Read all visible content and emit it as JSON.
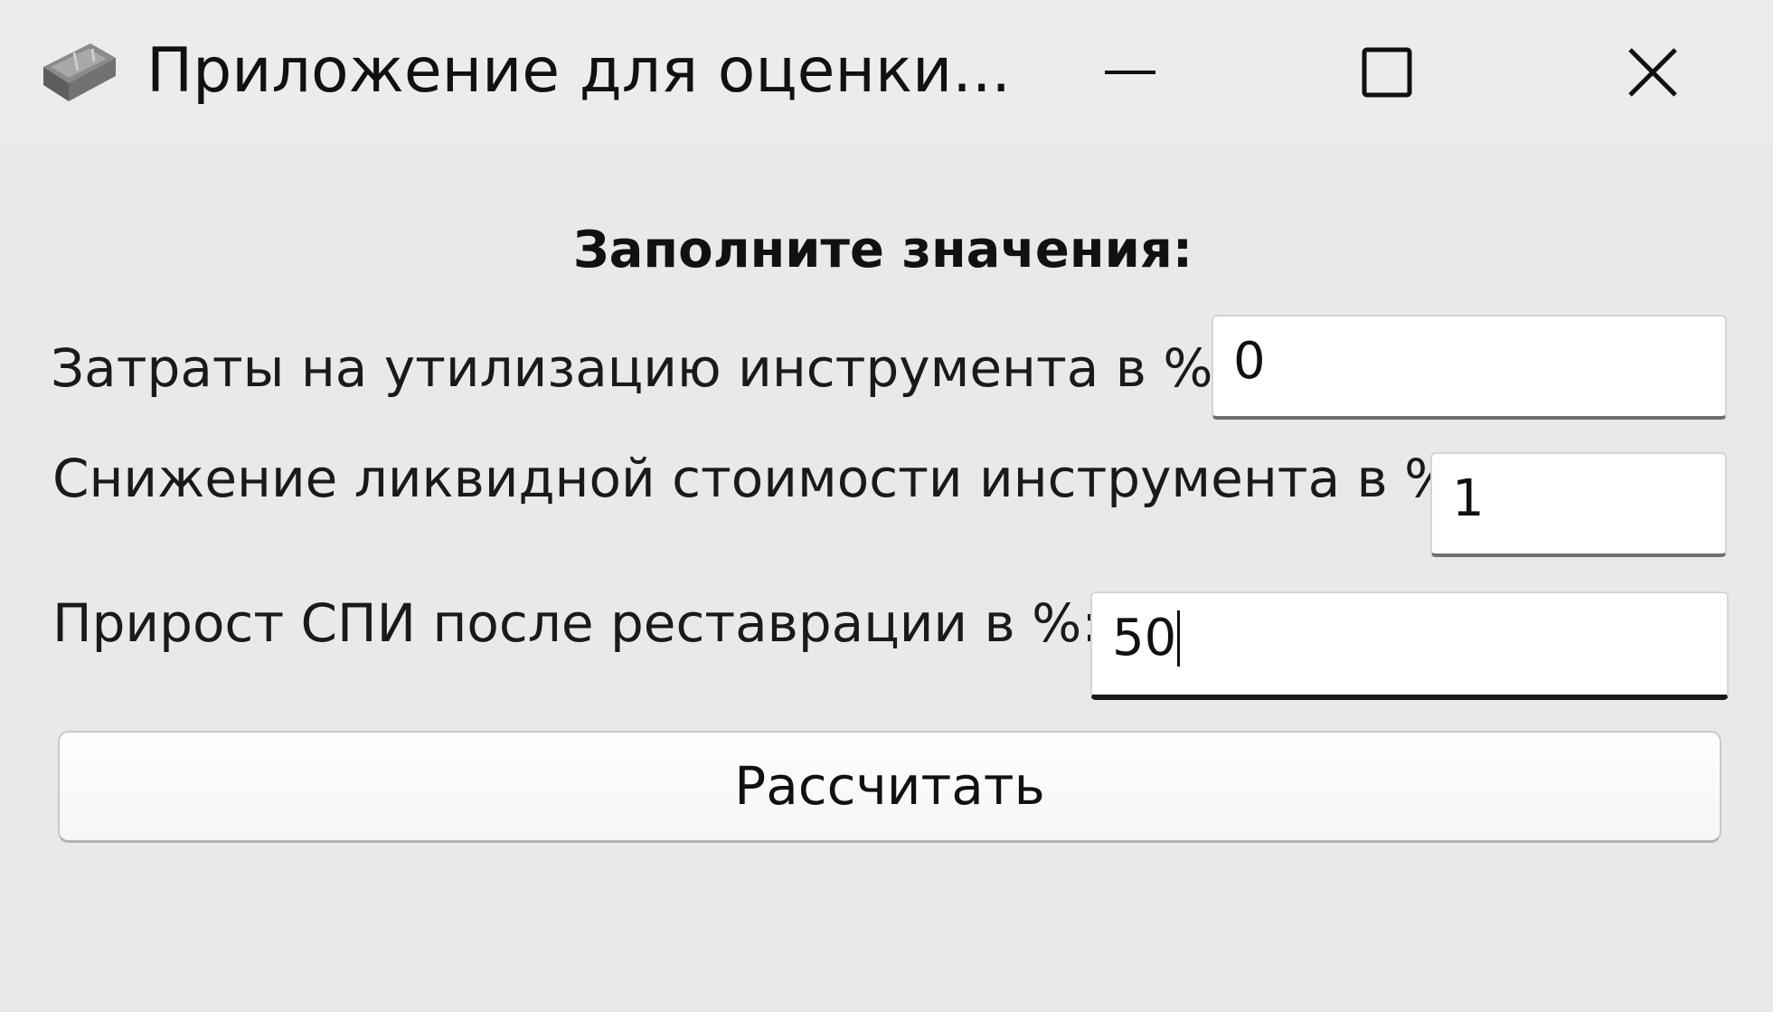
{
  "window": {
    "title": "Приложение для оценки..."
  },
  "titlebar_icons": {
    "app": "app-icon",
    "minimize": "minimize-icon",
    "maximize": "maximize-icon",
    "close": "close-icon"
  },
  "form": {
    "heading": "Заполните значения:",
    "fields": [
      {
        "label": "Затраты на утилизацию инструмента в %:",
        "value": "0"
      },
      {
        "label": "Снижение ликвидной стоимости инструмента в %:",
        "value": "1"
      },
      {
        "label": "Прирост СПИ после реставрации в %:",
        "value": "50"
      }
    ],
    "submit_label": "Рассчитать"
  }
}
